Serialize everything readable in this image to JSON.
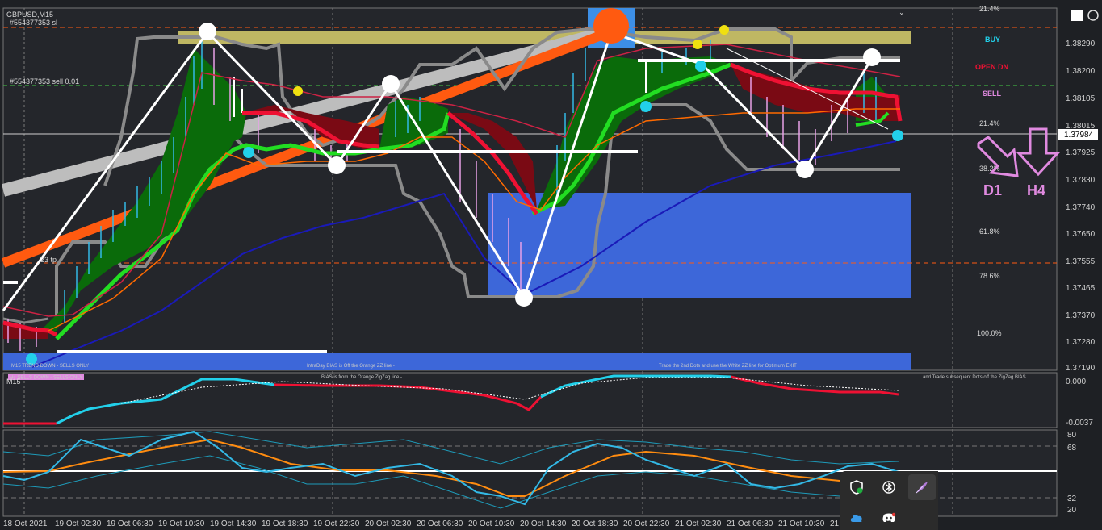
{
  "window": {
    "symbol_title": "GBPUSD,M15"
  },
  "order_labels": {
    "sl_label": "#554377353 sl",
    "sell_label": "#554377353 sell 0.01",
    "tp_label": "23 tp"
  },
  "price_axis": {
    "ticks": [
      "1.38290",
      "1.38200",
      "1.38105",
      "1.38015",
      "1.37925",
      "1.37830",
      "1.37740",
      "1.37650",
      "1.37555",
      "1.37465",
      "1.37370",
      "1.37280",
      "1.37190"
    ],
    "current_price": "1.37984"
  },
  "time_axis": {
    "ticks": [
      "18 Oct 2021",
      "19 Oct 02:30",
      "19 Oct 06:30",
      "19 Oct 10:30",
      "19 Oct 14:30",
      "19 Oct 18:30",
      "19 Oct 22:30",
      "20 Oct 02:30",
      "20 Oct 06:30",
      "20 Oct 10:30",
      "20 Oct 14:30",
      "20 Oct 18:30",
      "20 Oct 22:30",
      "21 Oct 02:30",
      "21 Oct 06:30",
      "21 Oct 10:30",
      "21"
    ]
  },
  "fib_levels": [
    "21.4%",
    "21.4%",
    "38.2%",
    "61.8%",
    "78.6%",
    "100.0%"
  ],
  "signals": {
    "buy": "BUY",
    "open_dn": "OPEN DN",
    "sell": "SELL"
  },
  "timeframe_arrows": {
    "d1": "D1",
    "h4": "H4"
  },
  "chart_notes": {
    "trend_badge": "M15 TREND DOWN - SELLS ONLY",
    "bias_note": "IntraDay BIAS is Off the Orange ZZ line -",
    "exit_note": "Trade the 2nd Dots and use the White ZZ line for Optimum EXIT"
  },
  "subwindow1": {
    "trend_badge": "H4 SELLS DOWN - SELLS ONLY",
    "label": "M15",
    "bias_note": "BIAS is from the Orange ZigZag line -",
    "dots_note": "and Trade subsequent Dots off the ZigZag BIAS",
    "scale_top": "0.000",
    "scale_bottom": "-0.0037"
  },
  "subwindow2": {
    "levels": [
      "80",
      "68",
      "32",
      "20"
    ]
  },
  "tray": {
    "icons": [
      "shield-icon",
      "bluetooth-icon",
      "feather-icon",
      "cloud-icon",
      "discord-icon"
    ]
  },
  "colors": {
    "bull_fill": "#0a6b0a",
    "bear_fill": "#7a0a14",
    "ma_green": "#22dd22",
    "ma_blue": "#1a1ab8",
    "zone_blue": "#3d67d9",
    "zone_gold": "#bfb763",
    "zz_orange": "#ff5a10",
    "cyan": "#22d0ea"
  }
}
